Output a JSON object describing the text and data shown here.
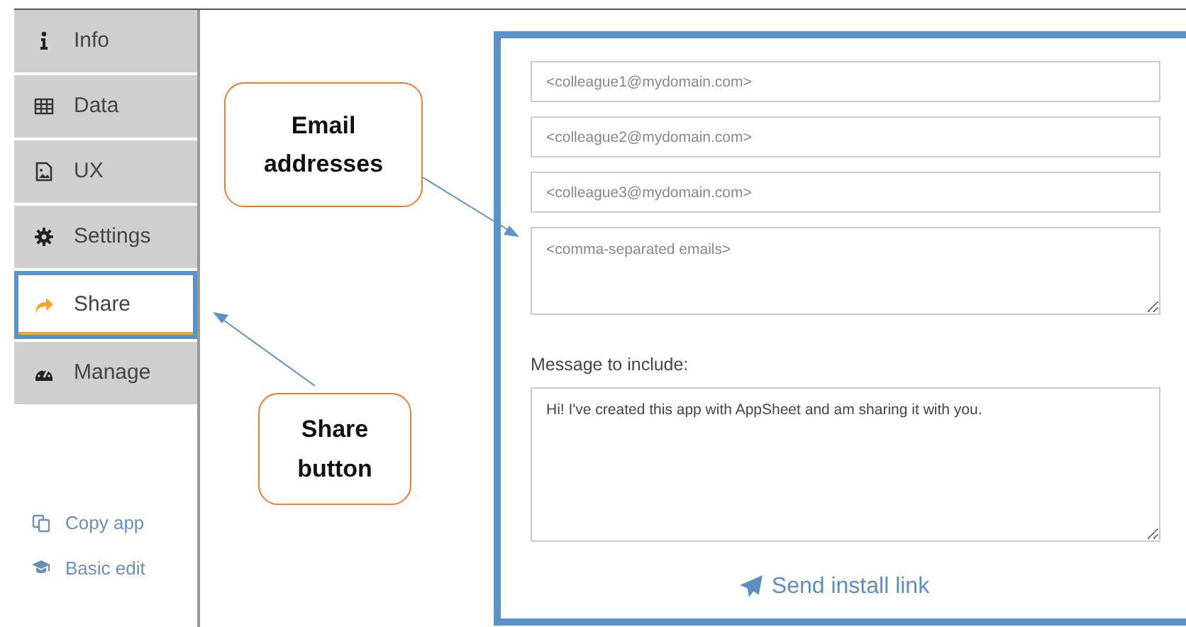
{
  "sidebar": {
    "items": [
      {
        "label": "Info",
        "selected": false
      },
      {
        "label": "Data",
        "selected": false
      },
      {
        "label": "UX",
        "selected": false
      },
      {
        "label": "Settings",
        "selected": false
      },
      {
        "label": "Share",
        "selected": true
      },
      {
        "label": "Manage",
        "selected": false
      }
    ],
    "links": [
      {
        "label": "Copy app"
      },
      {
        "label": "Basic edit"
      }
    ]
  },
  "share_form": {
    "email_fields": [
      {
        "placeholder": "<colleague1@mydomain.com>"
      },
      {
        "placeholder": "<colleague2@mydomain.com>"
      },
      {
        "placeholder": "<colleague3@mydomain.com>"
      }
    ],
    "emails_box": {
      "placeholder": "<comma-separated emails>"
    },
    "message_label": "Message to include:",
    "message": {
      "value": "Hi! I've created this app with AppSheet and am sharing it with you."
    },
    "send_button": "Send install link"
  },
  "callouts": [
    {
      "text": "Email addresses"
    },
    {
      "text": "Share button"
    }
  ]
}
